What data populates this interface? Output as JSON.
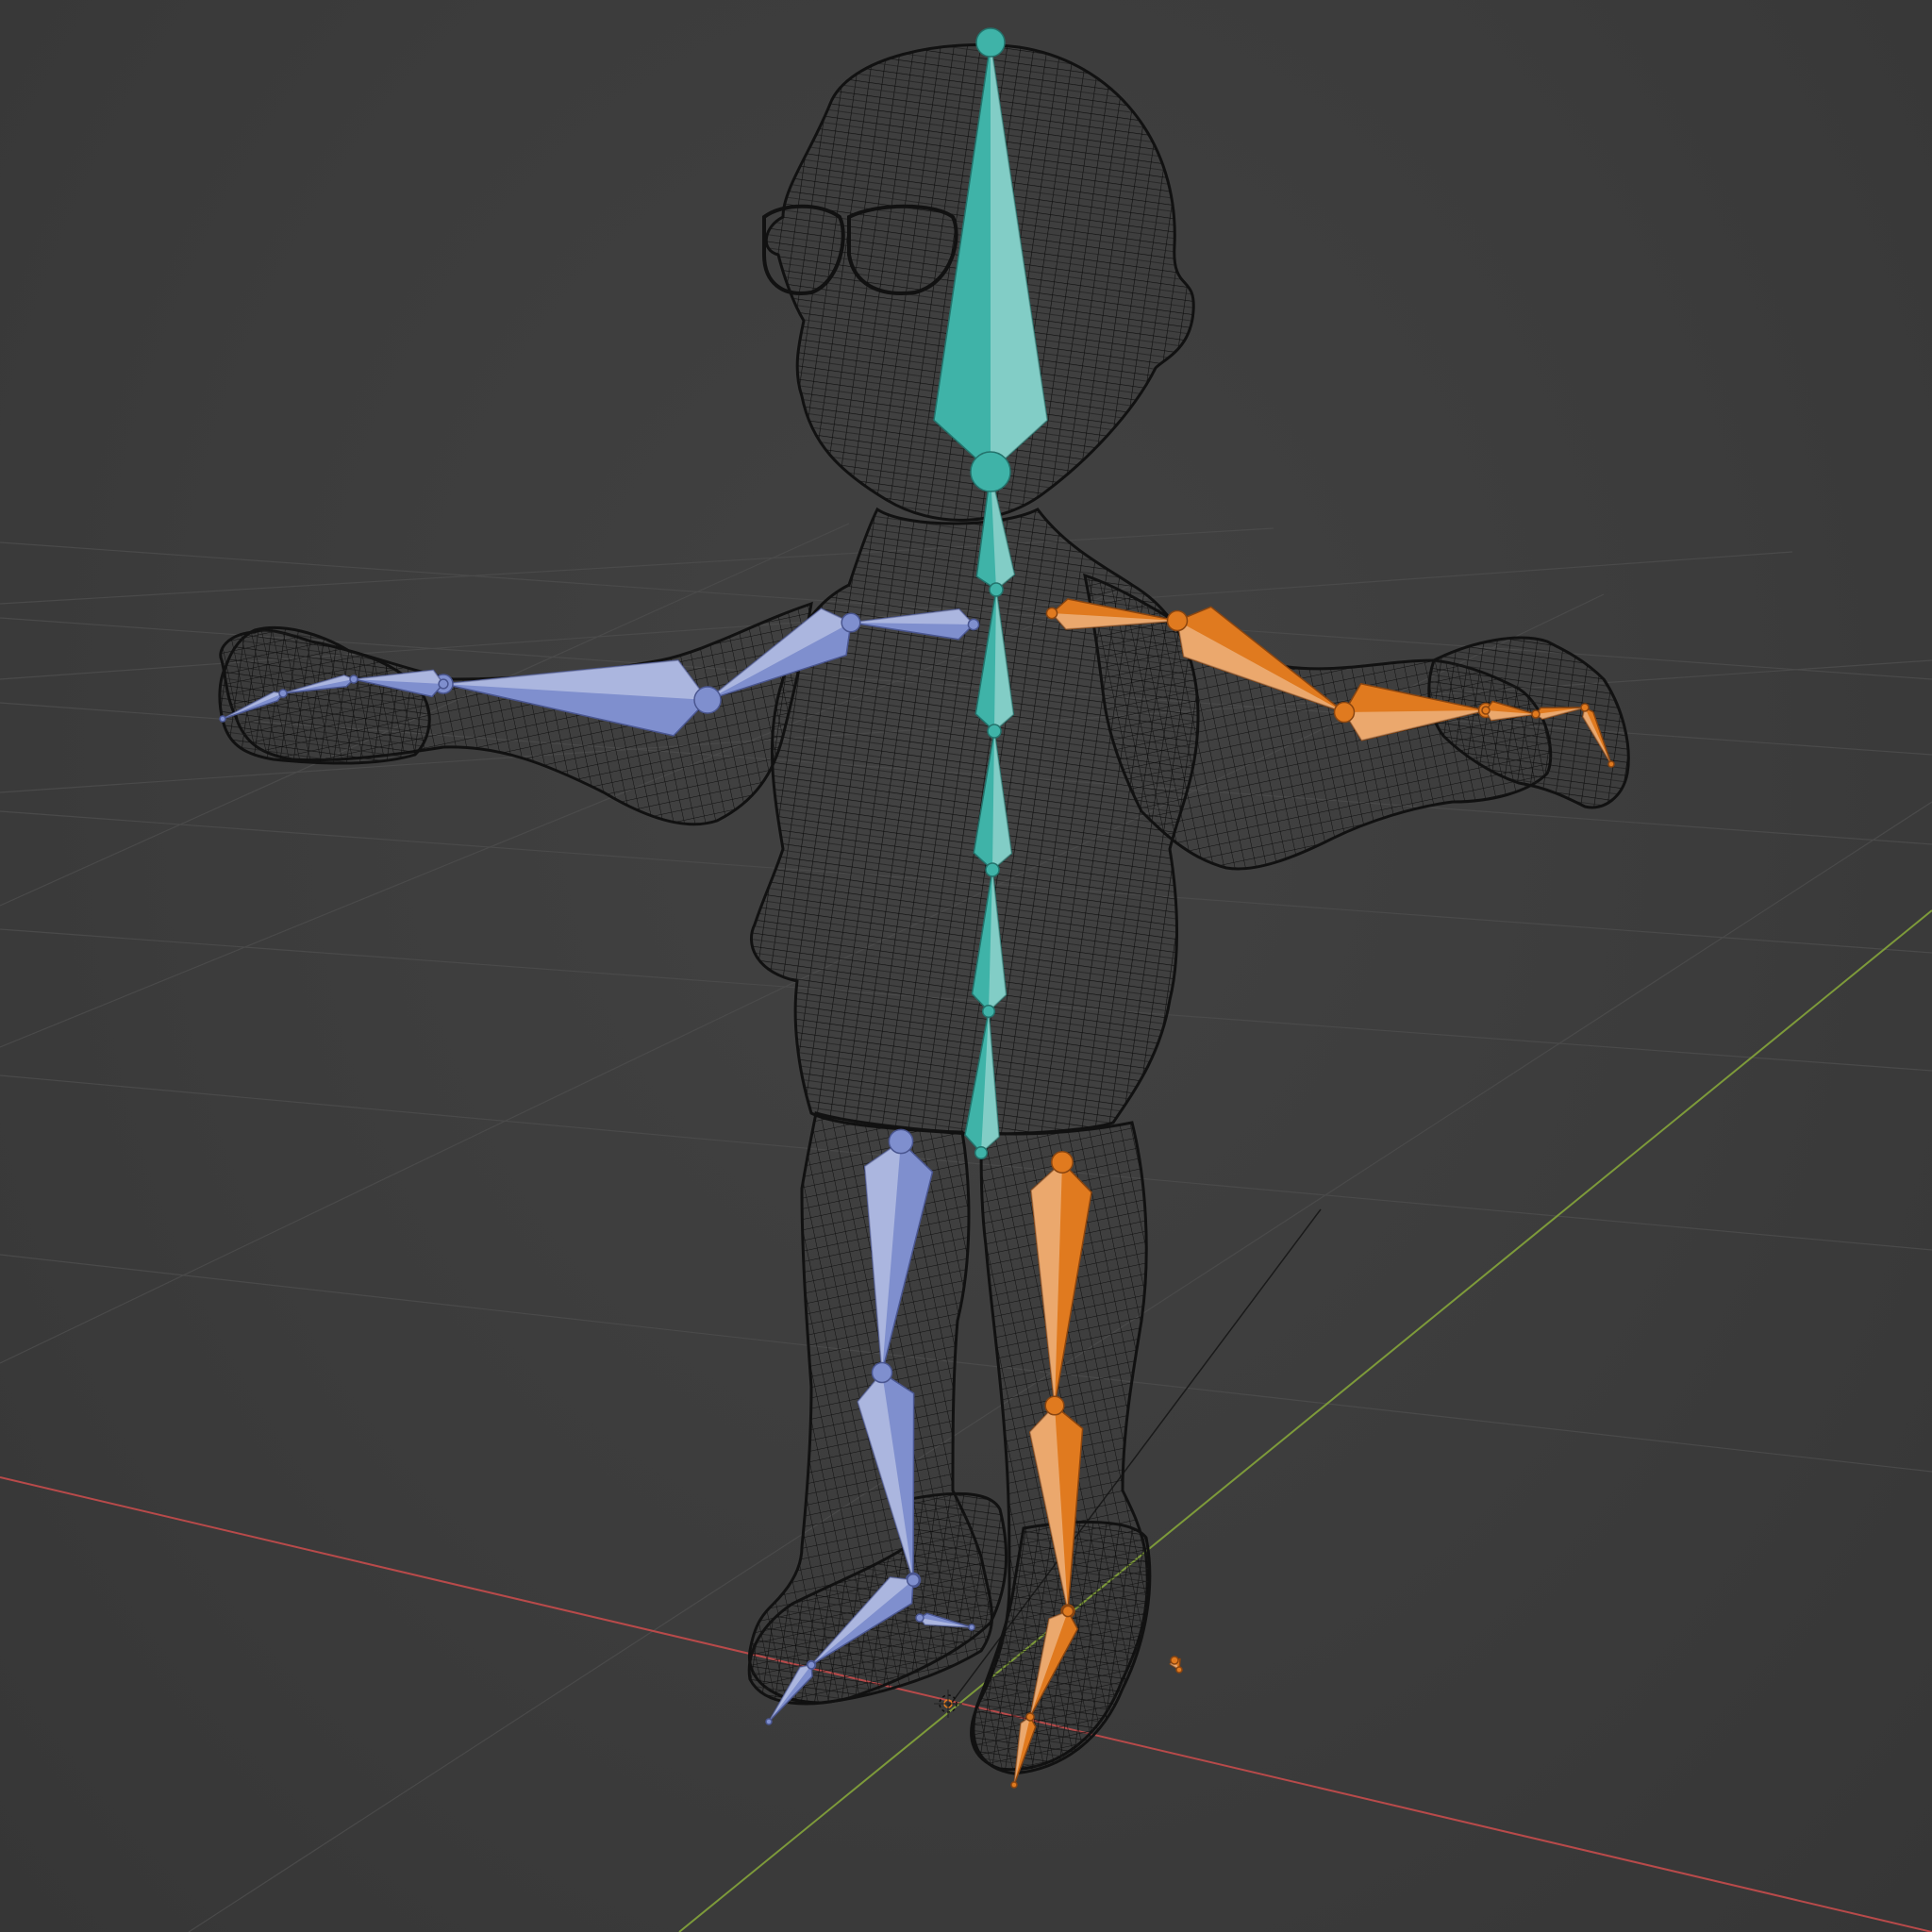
{
  "viewport": {
    "mode": "wireframe",
    "object": "character-mesh",
    "armature": "armature"
  },
  "colors": {
    "background": "#3b3b3b",
    "grid_line": "#4a4a4a",
    "x_axis": "#b84a4a",
    "y_axis": "#7d9a3a",
    "wire": "#111111",
    "bone_center": "#3fb3a8",
    "bone_left": "#7f8fce",
    "bone_right": "#e07a1f",
    "bone_outline_center": "#23736c",
    "bone_outline_left": "#4a5690",
    "bone_outline_right": "#8a4510"
  },
  "bone_groups": [
    {
      "name": "spine",
      "color_key": "bone_center"
    },
    {
      "name": "left",
      "color_key": "bone_left"
    },
    {
      "name": "right",
      "color_key": "bone_right"
    }
  ]
}
